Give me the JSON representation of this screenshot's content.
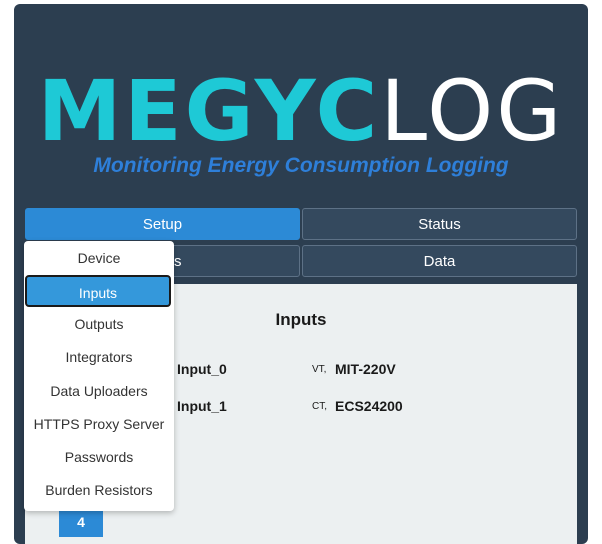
{
  "logo": {
    "part_a": "MEGYC",
    "part_b": "LOG"
  },
  "tagline": "Monitoring Energy Consumption Logging",
  "nav": {
    "setup": "Setup",
    "status": "Status",
    "row2_left_partial": "s",
    "data": "Data"
  },
  "content": {
    "title": "Inputs",
    "rows": [
      {
        "name": "Input_0",
        "type": "VT,",
        "model": "MIT-220V"
      },
      {
        "name": "Input_1",
        "type": "CT,",
        "model": "ECS24200"
      }
    ],
    "page_button": "4"
  },
  "dropdown": {
    "items": [
      {
        "label": "Device"
      },
      {
        "label": "Inputs",
        "selected": true
      },
      {
        "label": "Outputs"
      },
      {
        "label": "Integrators"
      },
      {
        "label": "Data Uploaders"
      },
      {
        "label": "HTTPS Proxy Server"
      },
      {
        "label": "Passwords"
      },
      {
        "label": "Burden Resistors"
      }
    ]
  },
  "colors": {
    "background": "#2c3e50",
    "accent": "#2c8ad6",
    "logo_cyan": "#1ec9d6",
    "tagline_blue": "#2e7fd9",
    "content_bg": "#ecf0f1"
  }
}
